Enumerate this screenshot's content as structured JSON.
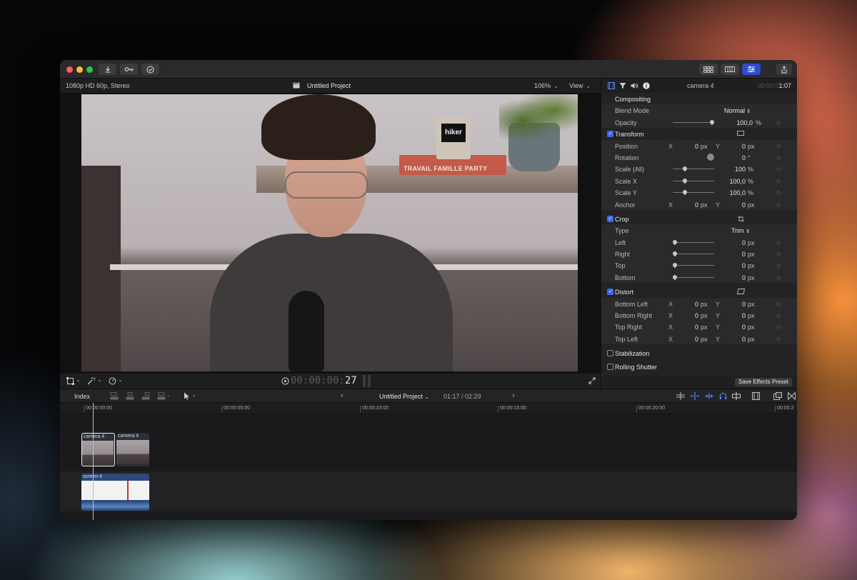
{
  "toolbar": {
    "import_icon": "download-arrow-icon",
    "keywords_icon": "key-icon",
    "check_icon": "checkmark-circle-icon",
    "share_icon": "share-icon"
  },
  "viewer": {
    "format": "1080p HD 60p, Stereo",
    "project_title": "Untitled Project",
    "zoom": "106%",
    "view_label": "View",
    "timecode_dim": "00:00:00:",
    "timecode_frames": "27",
    "video_overlay_screen": "hiker",
    "video_overlay_book": "TRAVAIL FAMILLE PARTY"
  },
  "inspector": {
    "clip_name": "camera 4",
    "duration_dim": "00:00:0",
    "duration": "1:07",
    "compositing": "Compositing",
    "blend_mode_label": "Blend Mode",
    "blend_mode_value": "Normal",
    "opacity_label": "Opacity",
    "opacity_value": "100,0",
    "percent": "%",
    "px": "px",
    "deg": "°",
    "x": "X",
    "y": "Y",
    "transform": "Transform",
    "position_label": "Position",
    "position_x": "0",
    "position_y": "0",
    "rotation_label": "Rotation",
    "rotation_value": "0",
    "scale_all_label": "Scale (All)",
    "scale_all_value": "100",
    "scale_x_label": "Scale X",
    "scale_x_value": "100,0",
    "scale_y_label": "Scale Y",
    "scale_y_value": "100,0",
    "anchor_label": "Anchor",
    "anchor_x": "0",
    "anchor_y": "0",
    "crop": "Crop",
    "type_label": "Type",
    "type_value": "Trim",
    "left_label": "Left",
    "left_value": "0",
    "right_label": "Right",
    "right_value": "0",
    "top_label": "Top",
    "top_value": "0",
    "bottom_label": "Bottom",
    "bottom_value": "0",
    "distort": "Distort",
    "bottom_left_label": "Bottom Left",
    "bottom_right_label": "Bottom Right",
    "top_right_label": "Top Right",
    "top_left_label": "Top Left",
    "zero": "0",
    "stabilization": "Stabilization",
    "rolling_shutter": "Rolling Shutter",
    "save_preset": "Save Effects Preset"
  },
  "timeline": {
    "index_label": "Index",
    "project_title": "Untitled Project",
    "position": "01:17 / 02:29",
    "ruler": [
      "00:00:00:00",
      "00:00:05:00",
      "00:00:10:00",
      "00:00:15:00",
      "00:00:20:00",
      "00:00:2"
    ],
    "clips": [
      {
        "name": "camera 4"
      },
      {
        "name": "camera 4"
      },
      {
        "name": "screen 4"
      }
    ]
  },
  "colors": {
    "accent": "#3a66f2",
    "close": "#ff5f57",
    "minimize": "#febc2e",
    "zoom": "#28c840"
  }
}
